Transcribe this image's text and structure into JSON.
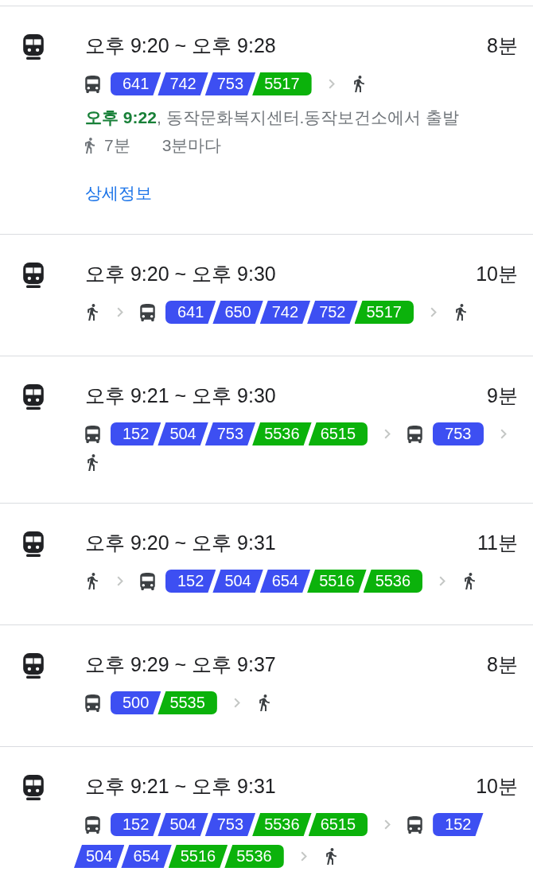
{
  "routes": [
    {
      "time_range": "오후 9:20 ~ 오후 9:28",
      "duration": "8분",
      "legs": [
        {
          "kind": "bus",
          "routes": [
            {
              "number": "641",
              "color": "#3d4ff2"
            },
            {
              "number": "742",
              "color": "#3d4ff2"
            },
            {
              "number": "753",
              "color": "#3d4ff2"
            },
            {
              "number": "5517",
              "color": "#0bb20b"
            }
          ]
        },
        {
          "kind": "walk"
        }
      ],
      "departure": "**오후 9:22**, 동작문화복지센터.동작보건소에서 출발",
      "walk_time": "7분",
      "frequency": "3분마다",
      "details_link": "상세정보"
    },
    {
      "time_range": "오후 9:20 ~ 오후 9:30",
      "duration": "10분",
      "legs": [
        {
          "kind": "walk"
        },
        {
          "kind": "bus",
          "routes": [
            {
              "number": "641",
              "color": "#3d4ff2"
            },
            {
              "number": "650",
              "color": "#3d4ff2"
            },
            {
              "number": "742",
              "color": "#3d4ff2"
            },
            {
              "number": "752",
              "color": "#3d4ff2"
            },
            {
              "number": "5517",
              "color": "#0bb20b"
            }
          ]
        },
        {
          "kind": "walk"
        }
      ]
    },
    {
      "time_range": "오후 9:21 ~ 오후 9:30",
      "duration": "9분",
      "legs": [
        {
          "kind": "bus",
          "routes": [
            {
              "number": "152",
              "color": "#3d4ff2"
            },
            {
              "number": "504",
              "color": "#3d4ff2"
            },
            {
              "number": "753",
              "color": "#3d4ff2"
            },
            {
              "number": "5536",
              "color": "#0bb20b"
            },
            {
              "number": "6515",
              "color": "#0bb20b"
            }
          ]
        },
        {
          "kind": "bus",
          "routes": [
            {
              "number": "753",
              "color": "#3d4ff2"
            }
          ]
        },
        {
          "kind": "walk"
        }
      ]
    },
    {
      "time_range": "오후 9:20 ~ 오후 9:31",
      "duration": "11분",
      "legs": [
        {
          "kind": "walk"
        },
        {
          "kind": "bus",
          "routes": [
            {
              "number": "152",
              "color": "#3d4ff2"
            },
            {
              "number": "504",
              "color": "#3d4ff2"
            },
            {
              "number": "654",
              "color": "#3d4ff2"
            },
            {
              "number": "5516",
              "color": "#0bb20b"
            },
            {
              "number": "5536",
              "color": "#0bb20b"
            }
          ]
        },
        {
          "kind": "walk"
        }
      ]
    },
    {
      "time_range": "오후 9:29 ~ 오후 9:37",
      "duration": "8분",
      "legs": [
        {
          "kind": "bus",
          "routes": [
            {
              "number": "500",
              "color": "#3d4ff2"
            },
            {
              "number": "5535",
              "color": "#0bb20b"
            }
          ]
        },
        {
          "kind": "walk"
        }
      ]
    },
    {
      "time_range": "오후 9:21 ~ 오후 9:31",
      "duration": "10분",
      "legs": [
        {
          "kind": "bus",
          "routes": [
            {
              "number": "152",
              "color": "#3d4ff2"
            },
            {
              "number": "504",
              "color": "#3d4ff2"
            },
            {
              "number": "753",
              "color": "#3d4ff2"
            },
            {
              "number": "5536",
              "color": "#0bb20b"
            },
            {
              "number": "6515",
              "color": "#0bb20b"
            }
          ]
        },
        {
          "kind": "bus",
          "routes": [
            {
              "number": "152",
              "color": "#3d4ff2"
            },
            {
              "number": "504",
              "color": "#3d4ff2"
            },
            {
              "number": "654",
              "color": "#3d4ff2"
            },
            {
              "number": "5516",
              "color": "#0bb20b"
            },
            {
              "number": "5536",
              "color": "#0bb20b"
            }
          ]
        },
        {
          "kind": "walk"
        }
      ]
    }
  ]
}
